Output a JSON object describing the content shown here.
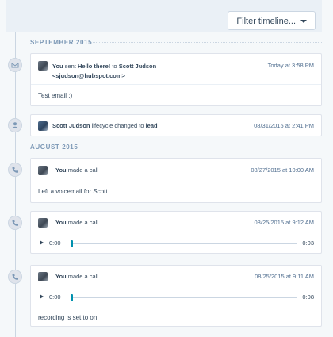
{
  "filter": {
    "label": "Filter timeline..."
  },
  "sections": {
    "sep": "SEPTEMBER 2015",
    "aug": "AUGUST 2015"
  },
  "email": {
    "you": "You",
    "sent": "sent",
    "subject": "Hello there!",
    "to": "to",
    "recipient": "Scott Judson",
    "address": "<sjudson@hubspot.com>",
    "time": "Today at 3:58 PM",
    "body": "Test email :)"
  },
  "lifecycle": {
    "name": "Scott Judson",
    "text": "lifecycle changed to",
    "stage": "lead",
    "time": "08/31/2015 at 2:41 PM"
  },
  "calls": [
    {
      "you": "You",
      "action": "made a call",
      "time": "08/27/2015 at 10:00 AM",
      "note": "Left a voicemail for Scott"
    },
    {
      "you": "You",
      "action": "made a call",
      "time": "08/25/2015 at 9:12 AM",
      "current": "0:00",
      "duration": "0:03"
    },
    {
      "you": "You",
      "action": "made a call",
      "time": "08/25/2015 at 9:11 AM",
      "current": "0:00",
      "duration": "0:08",
      "note": "recording is set to on"
    }
  ],
  "icons": {
    "email": "envelope-icon",
    "contact": "person-icon",
    "call": "phone-icon"
  }
}
